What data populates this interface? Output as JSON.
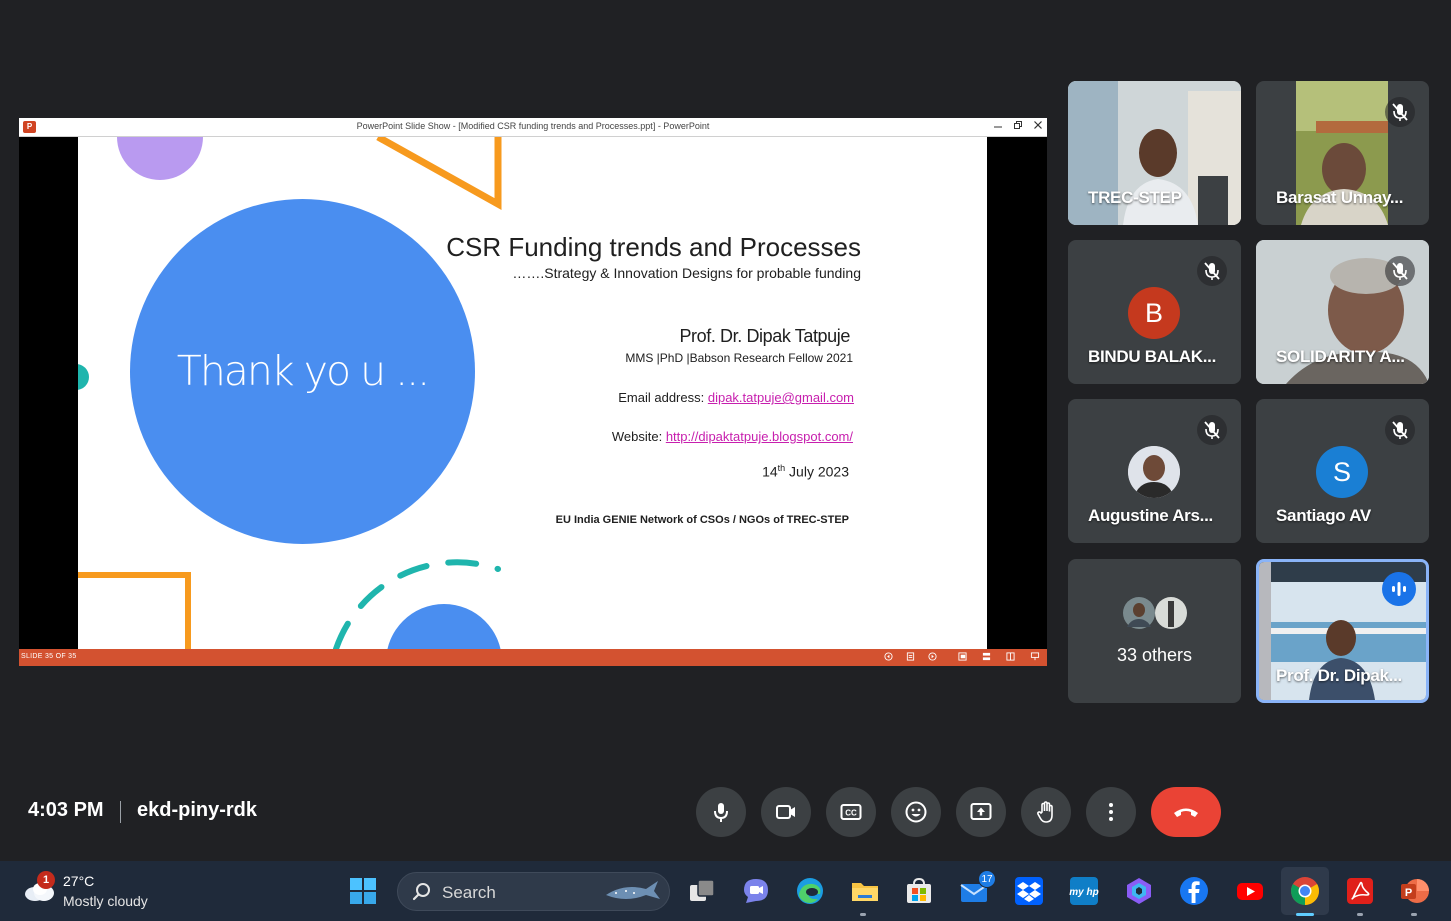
{
  "presentation": {
    "window_title": "PowerPoint Slide Show - [Modified CSR funding trends and Processes.ppt] - PowerPoint",
    "app_icon_letter": "P",
    "slide_counter": "SLIDE 35 OF 35",
    "slide": {
      "thank_you": "Thank yo u ...",
      "title": "CSR Funding trends and Processes",
      "subtitle": "…….Strategy & Innovation Designs for probable funding",
      "presenter_name": "Prof. Dr. Dipak Tatpuje",
      "presenter_credentials": "MMS |PhD |Babson Research Fellow 2021",
      "email_label": "Email address: ",
      "email_value": "dipak.tatpuje@gmail.com",
      "website_label": "Website: ",
      "website_value": "http://dipaktatpuje.blogspot.com/",
      "date_day": "14",
      "date_suffix": "th",
      "date_rest": " July 2023",
      "network": "EU India GENIE Network of CSOs / NGOs of TREC-STEP"
    },
    "colors": {
      "accent_blue": "#4a8ef0",
      "orange": "#f79a1e",
      "purple": "#b99af0",
      "teal": "#1fb5ad",
      "status_bar": "#d35230",
      "link": "#c71fae"
    }
  },
  "participants": [
    {
      "name": "TREC-STEP",
      "muted": false
    },
    {
      "name": "Barasat Unnay...",
      "muted": true
    },
    {
      "name": "BINDU BALAK...",
      "muted": true,
      "initial": "B",
      "avatar_color": "#c5391e"
    },
    {
      "name": "SOLIDARITY A...",
      "muted": true
    },
    {
      "name": "Augustine Ars...",
      "muted": true
    },
    {
      "name": "Santiago AV",
      "muted": true,
      "initial": "S",
      "avatar_color": "#1a7fd4"
    },
    {
      "name": "Prof. Dr. Dipak...",
      "speaking": true
    }
  ],
  "others": {
    "label": "33 others"
  },
  "meeting": {
    "time": "4:03 PM",
    "code": "ekd-piny-rdk",
    "controls": [
      "microphone",
      "camera",
      "captions",
      "emoji",
      "present-screen",
      "raise-hand",
      "more-options",
      "leave-call"
    ],
    "end_call_color": "#ea4335"
  },
  "taskbar": {
    "weather_badge": "1",
    "temperature": "27°C",
    "weather": "Mostly cloudy",
    "search_label": "Search",
    "mail_badge": "17",
    "apps": [
      "start",
      "task-view",
      "teams-chat",
      "edge",
      "file-explorer",
      "store",
      "mail",
      "dropbox",
      "myhp",
      "copilot",
      "facebook",
      "youtube",
      "chrome",
      "acrobat",
      "powerpoint"
    ]
  }
}
